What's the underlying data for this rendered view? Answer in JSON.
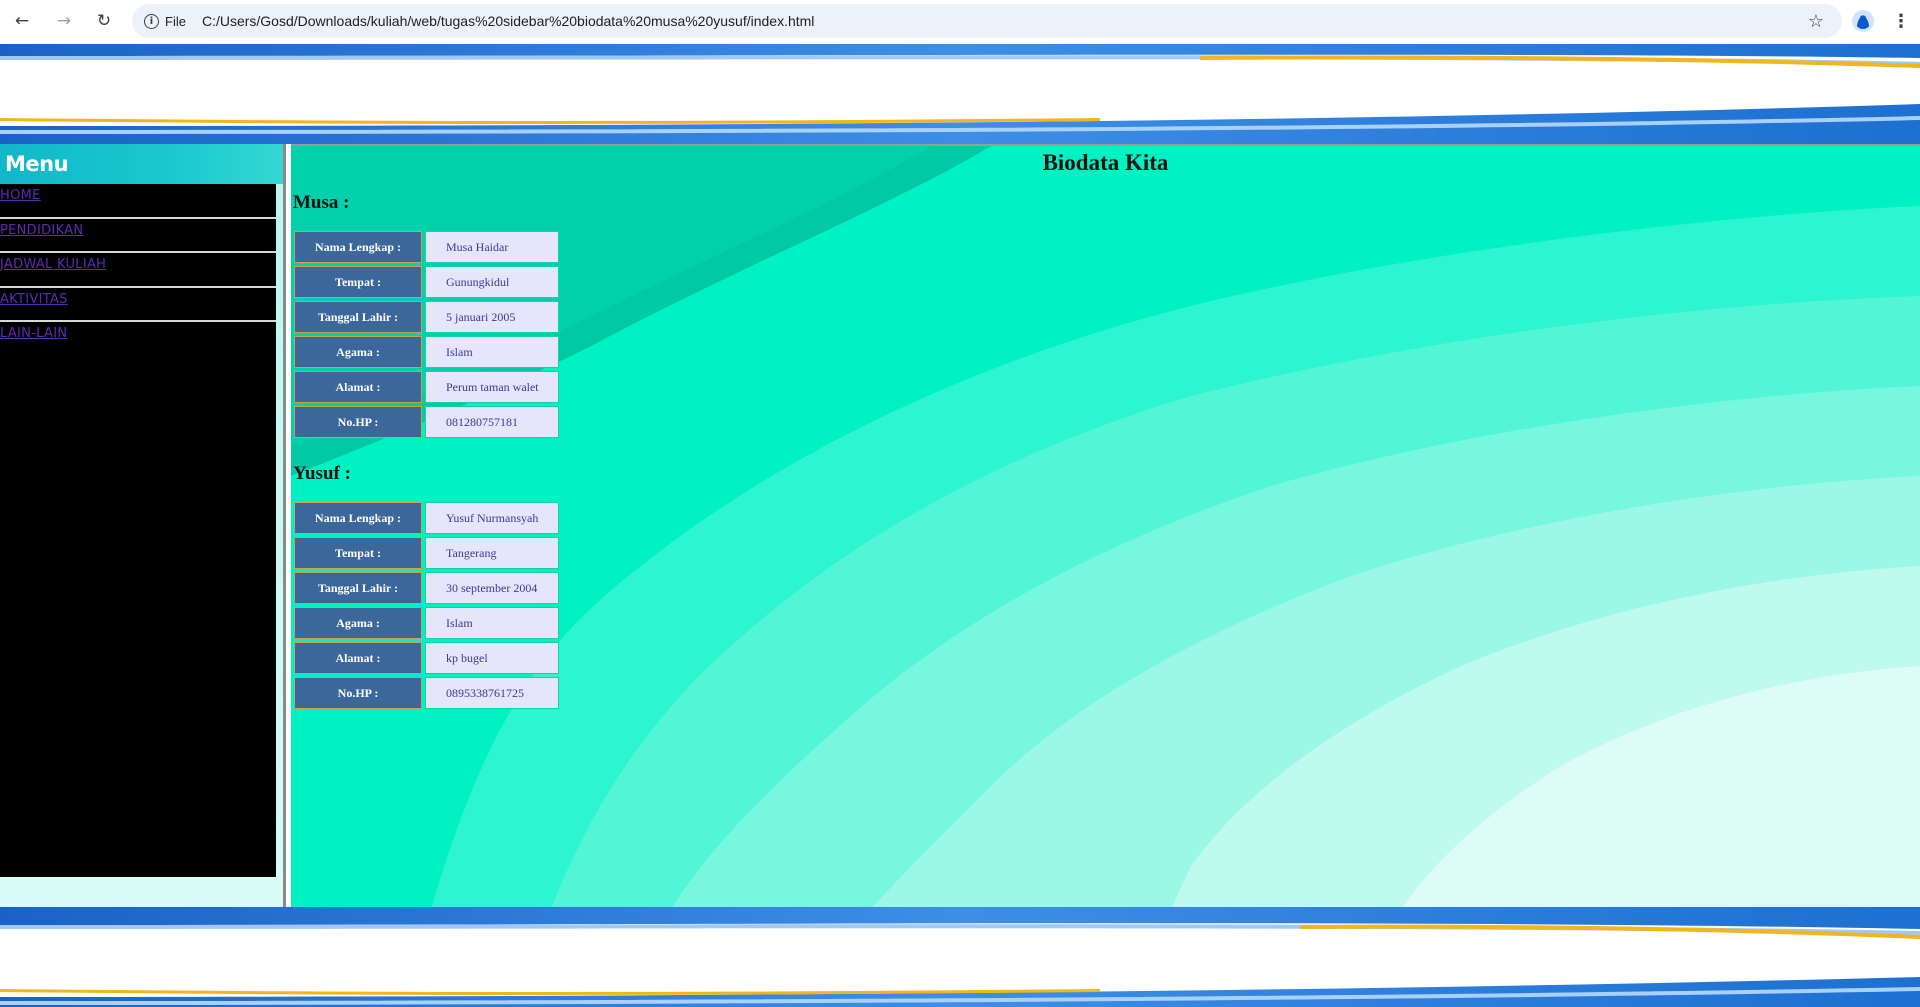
{
  "browser": {
    "scheme_label": "File",
    "url": "C:/Users/Gosd/Downloads/kuliah/web/tugas%20sidebar%20biodata%20musa%20yusuf/index.html"
  },
  "sidebar": {
    "title": "Menu",
    "items": [
      {
        "label": "HOME"
      },
      {
        "label": "PENDIDIKAN"
      },
      {
        "label": "JADWAL KULIAH"
      },
      {
        "label": "AKTIVITAS"
      },
      {
        "label": "LAIN-LAIN"
      }
    ]
  },
  "main": {
    "title": "Biodata Kita",
    "people": [
      {
        "name": "Musa :",
        "rows": [
          {
            "label": "Nama Lengkap :",
            "value": "Musa Haidar"
          },
          {
            "label": "Tempat :",
            "value": "Gunungkidul"
          },
          {
            "label": "Tanggal Lahir :",
            "value": "5 januari 2005"
          },
          {
            "label": "Agama :",
            "value": "Islam"
          },
          {
            "label": "Alamat :",
            "value": "Perum taman walet"
          },
          {
            "label": "No.HP :",
            "value": "081280757181"
          }
        ]
      },
      {
        "name": "Yusuf :",
        "rows": [
          {
            "label": "Nama Lengkap :",
            "value": "Yusuf Nurmansyah"
          },
          {
            "label": "Tempat :",
            "value": "Tangerang"
          },
          {
            "label": "Tanggal Lahir :",
            "value": "30 september 2004"
          },
          {
            "label": "Agama :",
            "value": "Islam"
          },
          {
            "label": "Alamat :",
            "value": "kp bugel"
          },
          {
            "label": "No.HP :",
            "value": "0895338761725"
          }
        ]
      }
    ]
  },
  "colors": {
    "sidebar_bg": "#000000",
    "menu_header": "#19c9cf",
    "link": "#5b2bb0",
    "label_cell": "#3b679a",
    "value_cell": "#e6e6fa",
    "content_bg": "#00f5c4"
  }
}
